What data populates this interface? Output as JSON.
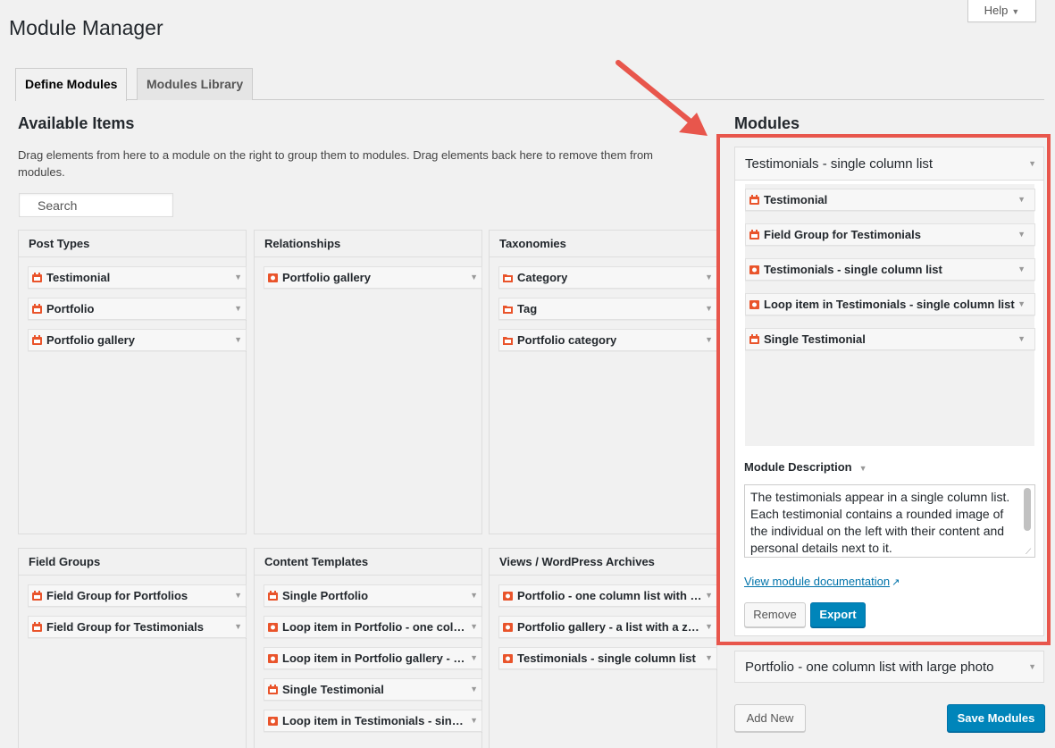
{
  "page": {
    "title": "Module Manager",
    "help_label": "Help"
  },
  "tabs": [
    {
      "label": "Define Modules"
    },
    {
      "label": "Modules Library"
    }
  ],
  "available": {
    "title": "Available Items",
    "description": "Drag elements from here to a module on the right to group them to modules. Drag elements back here to remove them from modules.",
    "search_placeholder": "Search"
  },
  "boxes": {
    "post_types": {
      "title": "Post Types",
      "items": [
        "Testimonial",
        "Portfolio",
        "Portfolio gallery"
      ]
    },
    "relationships": {
      "title": "Relationships",
      "items": [
        "Portfolio gallery"
      ]
    },
    "taxonomies": {
      "title": "Taxonomies",
      "items": [
        "Category",
        "Tag",
        "Portfolio category"
      ]
    },
    "field_groups": {
      "title": "Field Groups",
      "items": [
        "Field Group for Portfolios",
        "Field Group for Testimonials"
      ]
    },
    "content_templates": {
      "title": "Content Templates",
      "items": [
        "Single Portfolio",
        "Loop item in Portfolio - one column list with large photo",
        "Loop item in Portfolio gallery - a list with a zoom",
        "Single Testimonial",
        "Loop item in Testimonials - single column list"
      ]
    },
    "views": {
      "title": "Views / WordPress Archives",
      "items": [
        "Portfolio - one column list with large photo",
        "Portfolio gallery - a list with a zoom",
        "Testimonials - single column list"
      ]
    }
  },
  "modules": {
    "title": "Modules",
    "module1": {
      "name": "Testimonials - single column list",
      "items": [
        "Testimonial",
        "Field Group for Testimonials",
        "Testimonials - single column list",
        "Loop item in Testimonials - single column list",
        "Single Testimonial"
      ],
      "description_label": "Module Description",
      "description": "The testimonials appear in a single column list. Each testimonial contains a rounded image of the individual on the left with their content and personal details next to it.",
      "doc_link": "View module documentation",
      "remove_label": "Remove",
      "export_label": "Export"
    },
    "module2": {
      "name": "Portfolio - one column list with large photo"
    },
    "add_new_label": "Add New",
    "save_label": "Save Modules"
  },
  "colors": {
    "accent": "#0085ba",
    "highlight": "#e8564c",
    "icon": "#e9542b"
  }
}
